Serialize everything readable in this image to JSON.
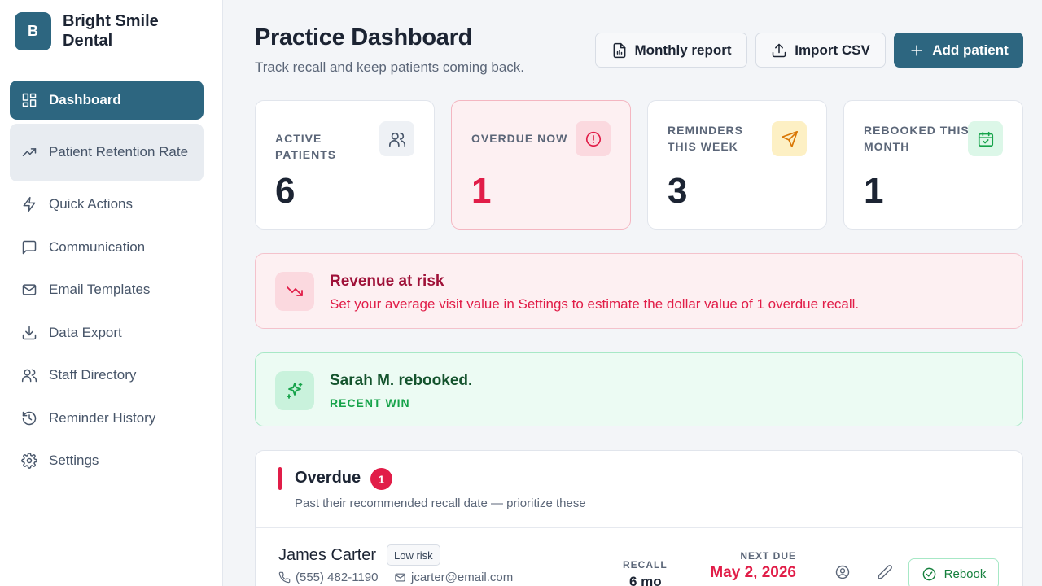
{
  "brand": {
    "logo_letter": "B",
    "name": "Bright Smile Dental"
  },
  "sidebar": {
    "items": [
      {
        "label": "Dashboard",
        "icon": "dashboard-icon"
      },
      {
        "label": "Patient Retention Rate",
        "icon": "trending-up-icon"
      },
      {
        "label": "Quick Actions",
        "icon": "lightning-icon"
      },
      {
        "label": "Communication",
        "icon": "message-icon"
      },
      {
        "label": "Email Templates",
        "icon": "mail-icon"
      },
      {
        "label": "Data Export",
        "icon": "download-icon"
      },
      {
        "label": "Staff Directory",
        "icon": "users-icon"
      },
      {
        "label": "Reminder History",
        "icon": "history-icon"
      },
      {
        "label": "Settings",
        "icon": "gear-icon"
      }
    ]
  },
  "header": {
    "title": "Practice Dashboard",
    "subtitle": "Track recall and keep patients coming back.",
    "buttons": {
      "report": "Monthly report",
      "import": "Import CSV",
      "add": "Add patient"
    }
  },
  "stats": [
    {
      "label": "ACTIVE PATIENTS",
      "value": "6",
      "icon": "users-icon",
      "color": "#475569"
    },
    {
      "label": "OVERDUE NOW",
      "value": "1",
      "icon": "alert-circle-icon",
      "color": "#e11d48"
    },
    {
      "label": "REMINDERS THIS WEEK",
      "value": "3",
      "icon": "send-icon",
      "color": "#d97706"
    },
    {
      "label": "REBOOKED THIS MONTH",
      "value": "1",
      "icon": "calendar-check-icon",
      "color": "#16a34a"
    }
  ],
  "banners": {
    "risk": {
      "title": "Revenue at risk",
      "text": "Set your average visit value in Settings to estimate the dollar value of 1 overdue recall."
    },
    "win": {
      "title": "Sarah M. rebooked.",
      "caption": "RECENT WIN"
    }
  },
  "overdue": {
    "title": "Overdue",
    "count": "1",
    "subtitle": "Past their recommended recall date — prioritize these",
    "patients": [
      {
        "name": "James Carter",
        "risk": "Low risk",
        "phone": "(555) 482-1190",
        "email": "jcarter@email.com",
        "recall_label": "RECALL",
        "recall": "6 mo",
        "next_due_label": "NEXT DUE",
        "next_due": "May 2, 2026",
        "action": "Rebook"
      }
    ]
  },
  "colors": {
    "primary": "#2d6680",
    "danger": "#e11d48",
    "success": "#15803d"
  }
}
